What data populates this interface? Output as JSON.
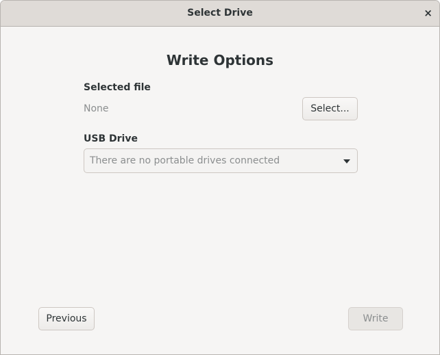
{
  "window": {
    "title": "Select Drive",
    "close": "×"
  },
  "main": {
    "heading": "Write Options",
    "selected_file_label": "Selected file",
    "selected_file_value": "None",
    "select_button": "Select...",
    "usb_label": "USB Drive",
    "usb_placeholder": "There are no portable drives connected"
  },
  "footer": {
    "previous": "Previous",
    "write": "Write"
  }
}
